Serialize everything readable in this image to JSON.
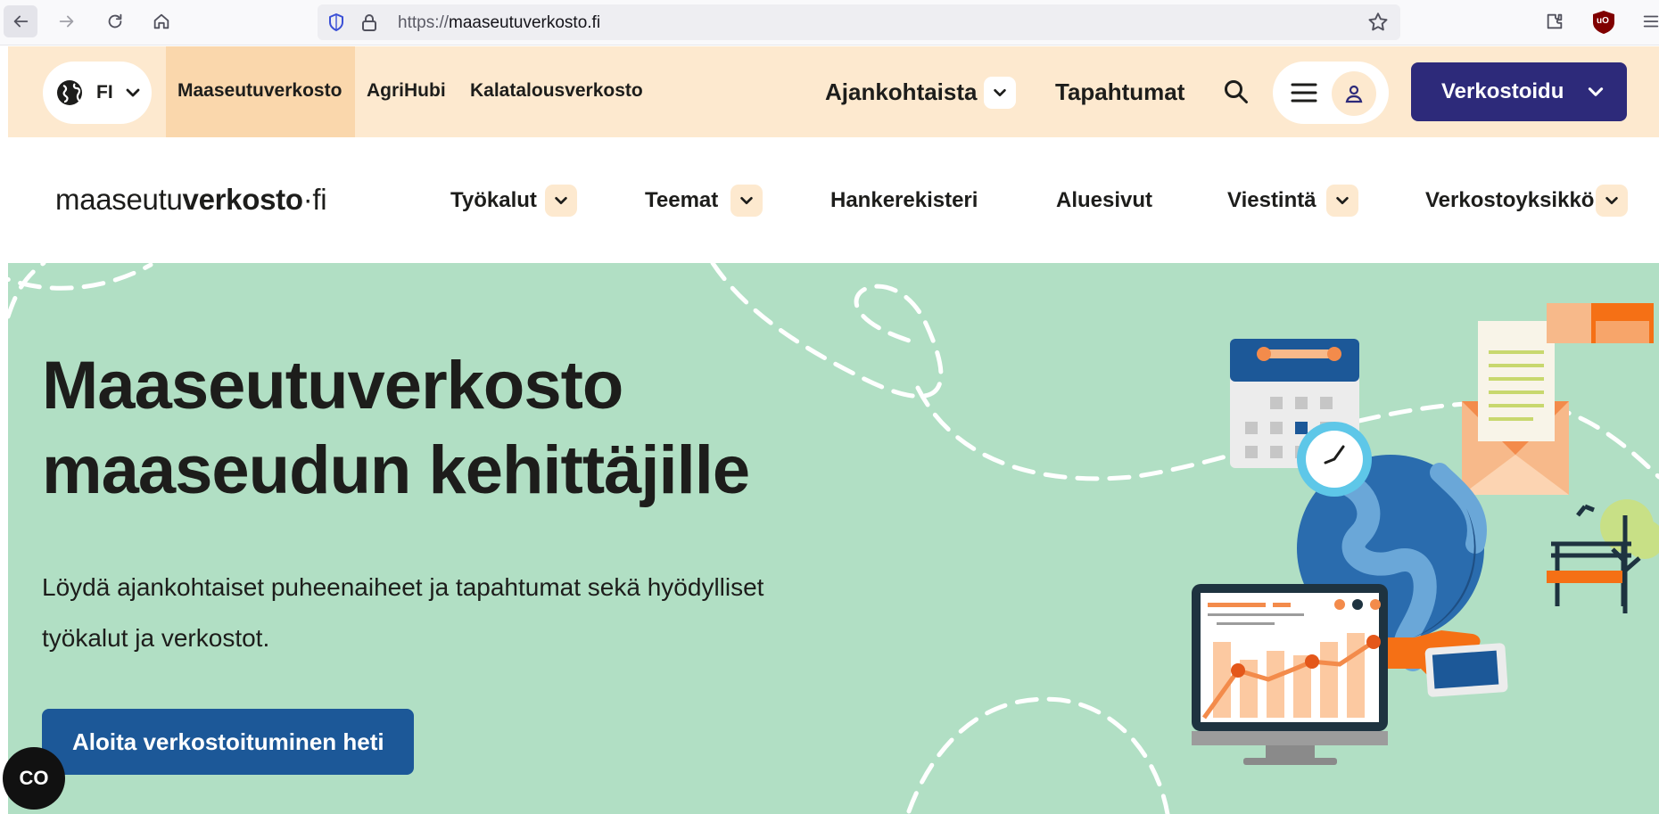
{
  "browser": {
    "url_prefix": "https://",
    "url_domain": "maaseutuverkosto.fi",
    "icons": [
      "back-arrow-icon",
      "forward-arrow-icon",
      "reload-icon",
      "home-icon",
      "shield-icon",
      "lock-icon",
      "star-icon",
      "extensions-icon",
      "ublock-icon",
      "menu-icon"
    ],
    "ublock_label": "uO"
  },
  "topbar": {
    "language": "FI",
    "sites": [
      {
        "label": "Maaseutuverkosto",
        "active": true
      },
      {
        "label": "AgriHubi",
        "active": false
      },
      {
        "label": "Kalatalousverkosto",
        "active": false
      }
    ],
    "news_label": "Ajankohtaista",
    "events_label": "Tapahtumat",
    "cta_label": "Verkostoidu"
  },
  "logo": {
    "part1": "maaseutu",
    "part2": "verkosto",
    "part3": "·fi"
  },
  "nav": {
    "items": [
      {
        "label": "Työkalut",
        "dropdown": true
      },
      {
        "label": "Teemat",
        "dropdown": true
      },
      {
        "label": "Hankerekisteri",
        "dropdown": false
      },
      {
        "label": "Aluesivut",
        "dropdown": false
      },
      {
        "label": "Viestintä",
        "dropdown": true
      },
      {
        "label": "Verkostoyksikkö",
        "dropdown": true
      }
    ]
  },
  "hero": {
    "title_line1": "Maaseutuverkosto",
    "title_line2": "maaseudun kehittäjille",
    "description": "Löydä ajankohtaiset puheenaiheet ja tapahtumat sekä hyödylliset työkalut ja verkostot.",
    "cta_label": "Aloita verkostoituminen heti"
  },
  "accessibility": {
    "label": "CO"
  },
  "colors": {
    "topbar_bg": "#fde9cf",
    "active_tab": "#fad7ac",
    "primary_dark": "#2d2a7a",
    "hero_bg": "#b1dfc4",
    "hero_cta": "#1c5898"
  }
}
